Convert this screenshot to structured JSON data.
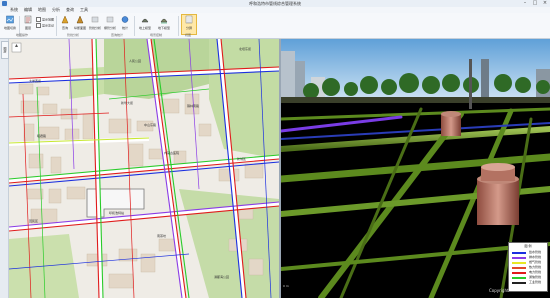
{
  "window": {
    "title": "呼和浩特市管线综合管理系统"
  },
  "menu": [
    "系统",
    "编辑",
    "地图",
    "分析",
    "查询",
    "工具"
  ],
  "ribbon": {
    "buttons": [
      {
        "id": "map-switch",
        "label": "地图切换",
        "icon": "map-switch-icon"
      },
      {
        "id": "layer",
        "label": "图层",
        "icon": "layer-icon"
      },
      {
        "id": "query",
        "label": "查询",
        "icon": "query-icon"
      },
      {
        "id": "profile",
        "label": "纵断面图",
        "icon": "profile-icon"
      },
      {
        "id": "pipe-analysis",
        "label": "管线分析",
        "icon": "pipe-analysis-icon"
      },
      {
        "id": "burst",
        "label": "爆管分析",
        "icon": "burst-icon"
      },
      {
        "id": "stat",
        "label": "统计",
        "icon": "stat-icon"
      },
      {
        "id": "ground",
        "label": "地上模型",
        "icon": "ground-icon"
      },
      {
        "id": "underground",
        "label": "地下模型",
        "icon": "underground-icon"
      },
      {
        "id": "split-view",
        "label": "分屏",
        "icon": "split-view-icon"
      }
    ],
    "checks": [
      "显示地图",
      "显示注记"
    ],
    "groups": [
      "地图操作",
      "管线分析",
      "查询统计",
      "场景控制",
      "视图"
    ]
  },
  "sidebar": {
    "tab": "图层"
  },
  "map": {
    "labels": [
      "北垣东街",
      "新华大街",
      "锡林南路",
      "中山东路",
      "大学西街",
      "昭君路",
      "人民公园",
      "内蒙古医院",
      "呼和浩特站",
      "新城区",
      "回民区",
      "南茶坊",
      "满都海公园"
    ]
  },
  "legend": {
    "title": "图 例",
    "items": [
      {
        "label": "给水管线",
        "color": "#1b2fe0"
      },
      {
        "label": "排水管线",
        "color": "#8a3ce6"
      },
      {
        "label": "燃气管线",
        "color": "#e8e824"
      },
      {
        "label": "热力管线",
        "color": "#e04a2a"
      },
      {
        "label": "电力管线",
        "color": "#e01b1b"
      },
      {
        "label": "通信管线",
        "color": "#2acb2a"
      },
      {
        "label": "工业管线",
        "color": "#222222"
      }
    ]
  },
  "scene": {
    "copyright": "Copyright",
    "scale": "0 m"
  },
  "colors": {
    "water": "#1b2fe0",
    "drain": "#8a3ce6",
    "power": "#e01b1b",
    "telecom": "#2acb2a",
    "gas": "#c8e830",
    "pipe3d": "#5c8a1e"
  }
}
